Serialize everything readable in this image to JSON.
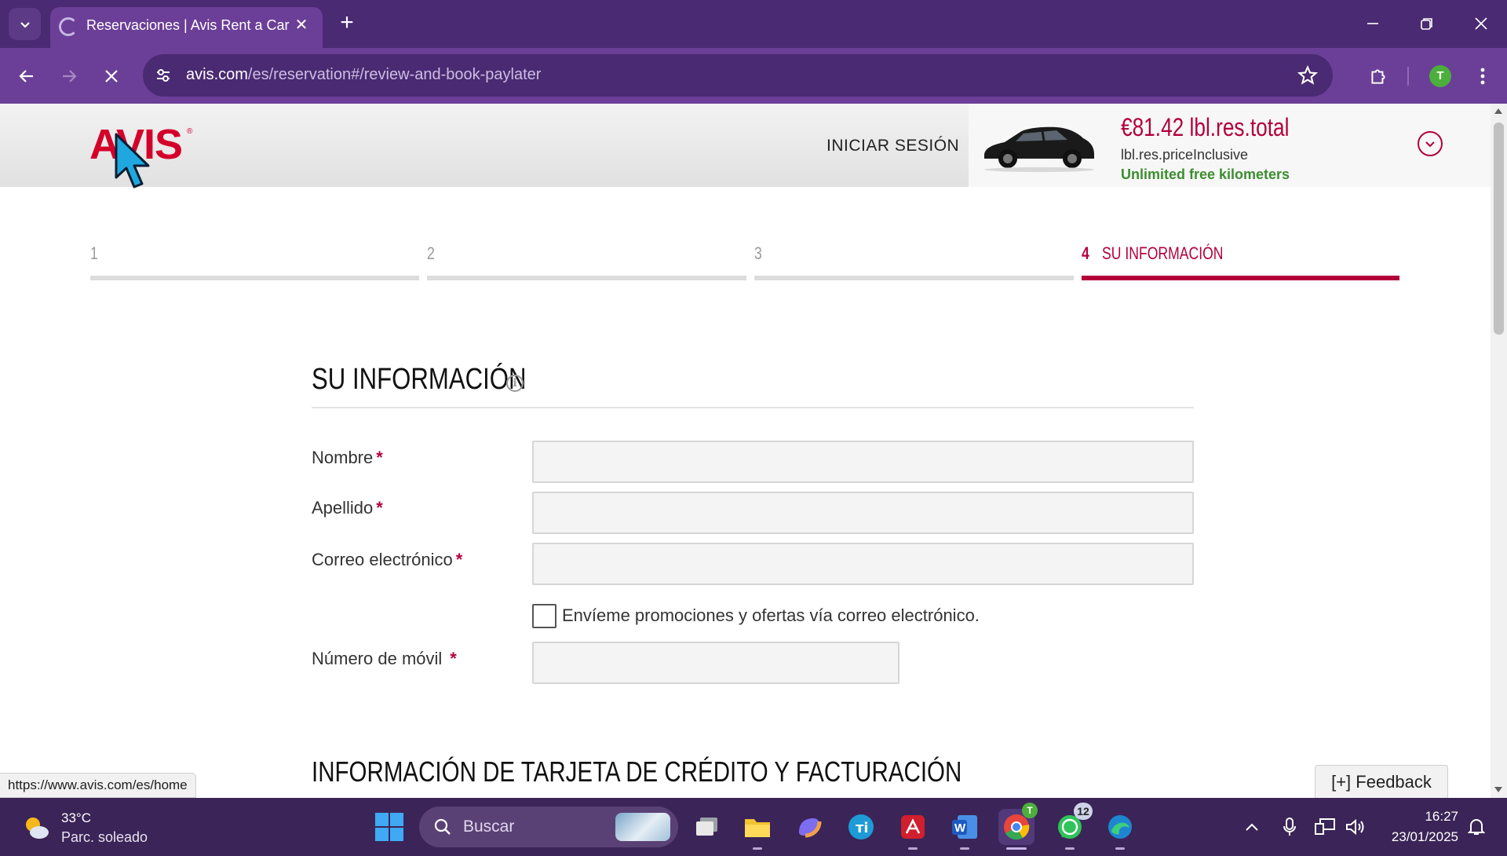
{
  "browser": {
    "tab_title": "Reservaciones | Avis Rent a Car",
    "url_domain": "avis.com",
    "url_path": "/es/reservation#/review-and-book-paylater",
    "profile_initial": "T"
  },
  "header": {
    "logo_text": "AVIS",
    "signin_label": "INICIAR SESIÓN",
    "price": "€81.42 lbl.res.total",
    "price_note": "lbl.res.priceInclusive",
    "unlimited_km": "Unlimited free kilometers"
  },
  "steps": [
    {
      "num": "1",
      "label": ""
    },
    {
      "num": "2",
      "label": ""
    },
    {
      "num": "3",
      "label": ""
    },
    {
      "num": "4",
      "label": "SU INFORMACIÓN"
    }
  ],
  "progress": {
    "current_step": 4,
    "total_steps": 4
  },
  "form": {
    "section_title": "SU INFORMACIÓN",
    "first_name_label": "Nombre",
    "last_name_label": "Apellido",
    "email_label": "Correo electrónico",
    "required_mark": "*",
    "promo_label": "Envíeme promociones y ofertas vía correo electrónico.",
    "promo_checked": false,
    "mobile_label": "Número de móvil",
    "first_name_value": "",
    "last_name_value": "",
    "email_value": "",
    "mobile_value": ""
  },
  "billing": {
    "section_title": "INFORMACIÓN DE TARJETA DE CRÉDITO Y FACTURACIÓN"
  },
  "status_url": "https://www.avis.com/es/home",
  "feedback_label": "[+] Feedback",
  "taskbar": {
    "weather_temp": "33°C",
    "weather_desc": "Parc. soleado",
    "search_placeholder": "Buscar",
    "whatsapp_badge": "12",
    "chrome_badge": "T",
    "time": "16:27",
    "date": "23/01/2025"
  },
  "colors": {
    "brand_red": "#b3003b",
    "browser_purple": "#6b3f97",
    "success_green": "#3c8d2f"
  }
}
